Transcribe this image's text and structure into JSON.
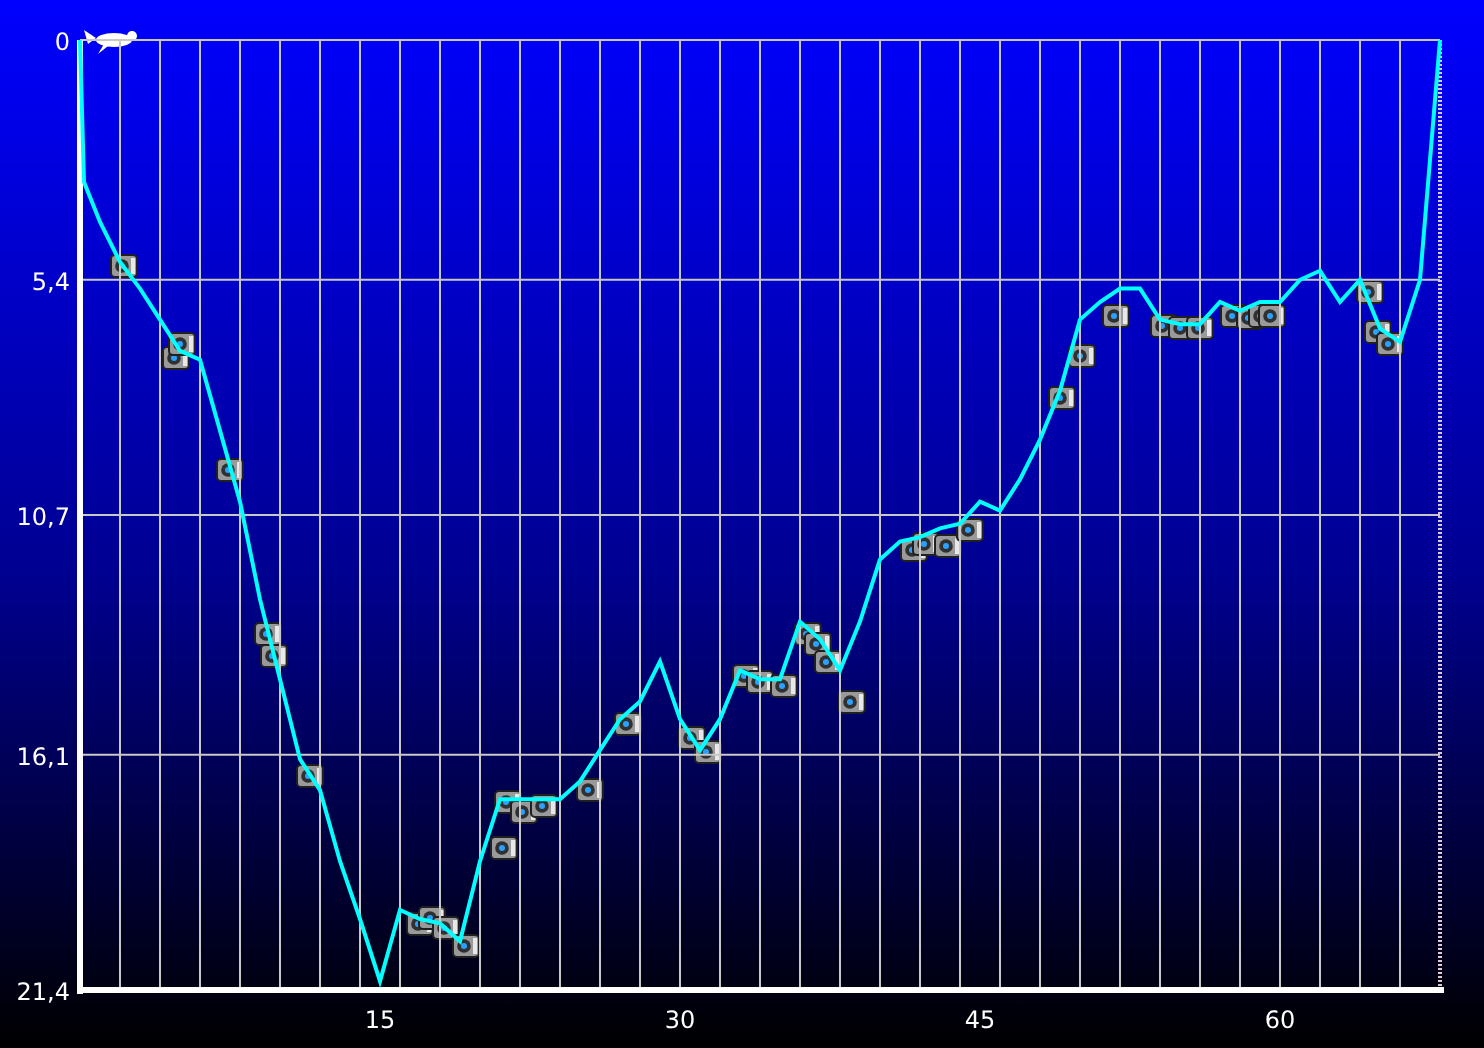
{
  "chart_data": {
    "type": "line",
    "xlim": [
      0,
      68
    ],
    "ylim": [
      21.4,
      0
    ],
    "grid": true,
    "x": [
      0,
      0.2,
      1,
      2,
      3,
      4,
      5,
      6,
      7,
      8,
      9,
      10,
      11,
      12,
      13,
      14,
      15,
      16,
      17,
      18,
      19,
      20,
      21,
      22,
      23,
      24,
      25,
      26,
      27,
      28,
      29,
      30,
      31,
      32,
      33,
      34,
      35,
      36,
      37,
      38,
      39,
      40,
      41,
      42,
      43,
      44,
      45,
      46,
      47,
      48,
      49,
      50,
      51,
      52,
      53,
      54,
      55,
      56,
      57,
      58,
      59,
      60,
      61,
      62,
      63,
      64,
      65,
      66,
      67,
      68
    ],
    "series": [
      {
        "color": "#00ffff",
        "values": [
          0,
          3.2,
          4.1,
          5.0,
          5.6,
          6.3,
          7.0,
          7.2,
          8.8,
          10.4,
          12.6,
          14.4,
          16.2,
          16.9,
          18.5,
          19.8,
          21.2,
          19.6,
          19.8,
          19.9,
          20.3,
          18.5,
          17.1,
          17.1,
          17.1,
          17.1,
          16.7,
          16.0,
          15.3,
          14.9,
          14.0,
          15.3,
          16.0,
          15.3,
          14.2,
          14.4,
          14.4,
          13.1,
          13.5,
          14.2,
          13.1,
          11.7,
          11.3,
          11.2,
          11.0,
          10.9,
          10.4,
          10.6,
          9.9,
          9.0,
          7.9,
          6.3,
          5.9,
          5.6,
          5.6,
          6.3,
          6.4,
          6.4,
          5.9,
          6.1,
          5.9,
          5.9,
          5.4,
          5.2,
          5.9,
          5.4,
          6.5,
          6.8,
          5.4,
          0
        ]
      }
    ],
    "xticks": [
      15,
      30,
      45,
      60
    ],
    "yticks": [
      {
        "value": 0,
        "label": "0"
      },
      {
        "value": 5.4,
        "label": "5,4"
      },
      {
        "value": 10.7,
        "label": "10,7"
      },
      {
        "value": 16.1,
        "label": "16,1"
      },
      {
        "value": 21.4,
        "label": "21,4"
      }
    ]
  }
}
